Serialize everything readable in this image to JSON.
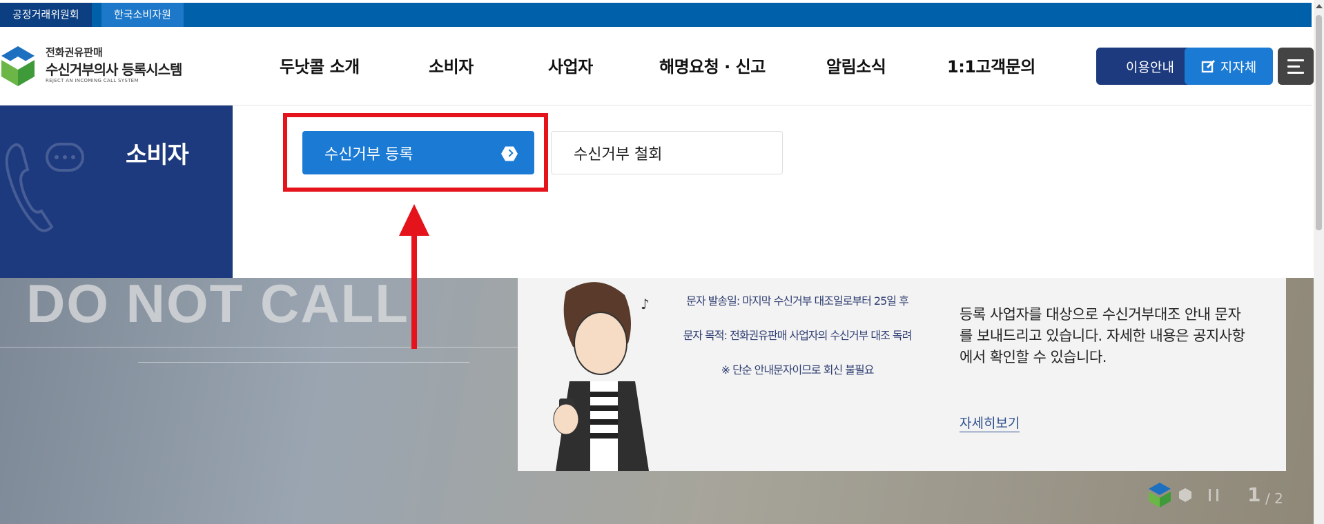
{
  "topbar": {
    "ftc": "공정거래위원회",
    "kca": "한국소비자원"
  },
  "logo": {
    "line1": "전화권유판매",
    "line2": "수신거부의사 등록시스템",
    "line3": "REJECT AN INCOMING CALL SYSTEM"
  },
  "nav": [
    "두낫콜 소개",
    "소비자",
    "사업자",
    "해명요청 · 신고",
    "알림소식",
    "1:1고객문의"
  ],
  "buttons": {
    "guide": "이용안내",
    "gov": "지자체"
  },
  "panel": {
    "title": "소비자",
    "register": "수신거부 등록",
    "withdraw": "수신거부 철회"
  },
  "hero": {
    "bg_text": "DO NOT CALL",
    "notice": [
      "문자 발송일: 마지막 수신거부 대조일로부터 25일 후",
      "문자 목적: 전화권유판매 사업자의 수신거부 대조 독려",
      "※ 단순 안내문자이므로 회신 불필요"
    ],
    "desc": "등록 사업자를 대상으로 수신거부대조 안내 문자를 보내드리고 있습니다. 자세한 내용은 공지사항에서 확인할 수 있습니다.",
    "more": "자세히보기",
    "page_current": "1",
    "page_total": "/ 2"
  },
  "colors": {
    "navy": "#1e3a7e",
    "blue": "#1a7ad4",
    "topbar": "#0060a9",
    "annotation": "#e5131b"
  }
}
